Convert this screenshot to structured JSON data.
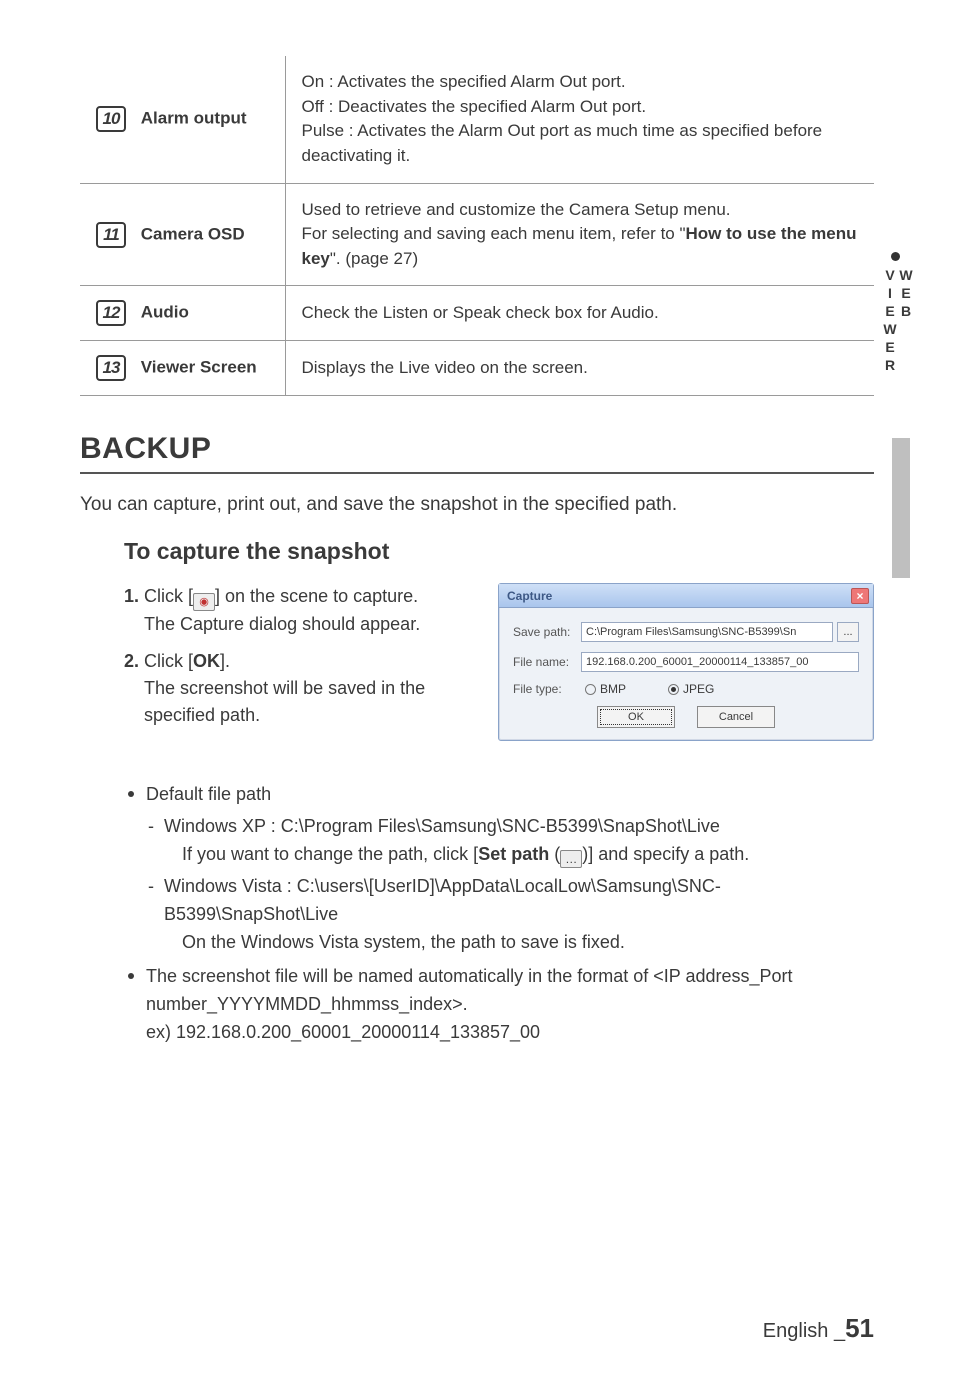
{
  "table_rows": [
    {
      "num": "10",
      "label": "Alarm output",
      "desc_lines": [
        "On : Activates the specified Alarm Out port.",
        "Off : Deactivates the specified Alarm Out port.",
        "Pulse : Activates the Alarm Out port as much time as specified before deactivating it."
      ]
    },
    {
      "num": "11",
      "label": "Camera OSD",
      "desc_lines": [
        "Used to retrieve and customize the Camera Setup menu.",
        "For selecting and saving each menu item, refer to \"How to use the menu key\". (page 27)"
      ]
    },
    {
      "num": "12",
      "label": "Audio",
      "desc_lines": [
        "Check the Listen or Speak check box for Audio."
      ]
    },
    {
      "num": "13",
      "label": "Viewer  Screen",
      "desc_lines": [
        "Displays the Live video on the screen."
      ]
    }
  ],
  "section": {
    "title": "BACKUP"
  },
  "intro": "You can capture, print out, and save the snapshot in the specified path.",
  "subtitle": "To capture the snapshot",
  "steps": {
    "s1": {
      "n": "1.",
      "pre": "Click [",
      "post": "] on the scene to capture.",
      "line2": "The Capture dialog should appear."
    },
    "s2": {
      "n": "2.",
      "pre": "Click [",
      "bold": "OK",
      "post": "].",
      "line2": "The screenshot will be saved in the specified path."
    }
  },
  "dialog": {
    "title": "Capture",
    "save_path_label": "Save path:",
    "save_path_value": "C:\\Program Files\\Samsung\\SNC-B5399\\Sn",
    "browse_btn": "...",
    "file_name_label": "File name:",
    "file_name_value": "192.168.0.200_60001_20000114_133857_00",
    "file_type_label": "File type:",
    "radio_bmp": "BMP",
    "radio_jpeg": "JPEG",
    "ok": "OK",
    "cancel": "Cancel"
  },
  "bullets": {
    "b1_head": "Default file path",
    "b1_sub1_line1": "Windows XP : C:\\Program Files\\Samsung\\SNC-B5399\\SnapShot\\Live",
    "b1_sub1_line2_pre": "If you want to change the path, click [",
    "b1_sub1_line2_bold": "Set path",
    "b1_sub1_line2_mid": " (",
    "b1_sub1_line2_post": ")] and specify a path.",
    "b1_sub2_line1": "Windows Vista : C:\\users\\[UserID]\\AppData\\LocalLow\\Samsung\\SNC-B5399\\SnapShot\\Live",
    "b1_sub2_line2": "On the Windows Vista system, the path to save is fixed.",
    "b2_line1": "The screenshot file will be named automatically in the format of <IP address_Port number_YYYYMMDD_hhmmss_index>.",
    "b2_line2": "ex) 192.168.0.200_60001_20000114_133857_00"
  },
  "side": {
    "label": "WEB VIEWER"
  },
  "footer": {
    "lang": "English _",
    "page": "51"
  }
}
